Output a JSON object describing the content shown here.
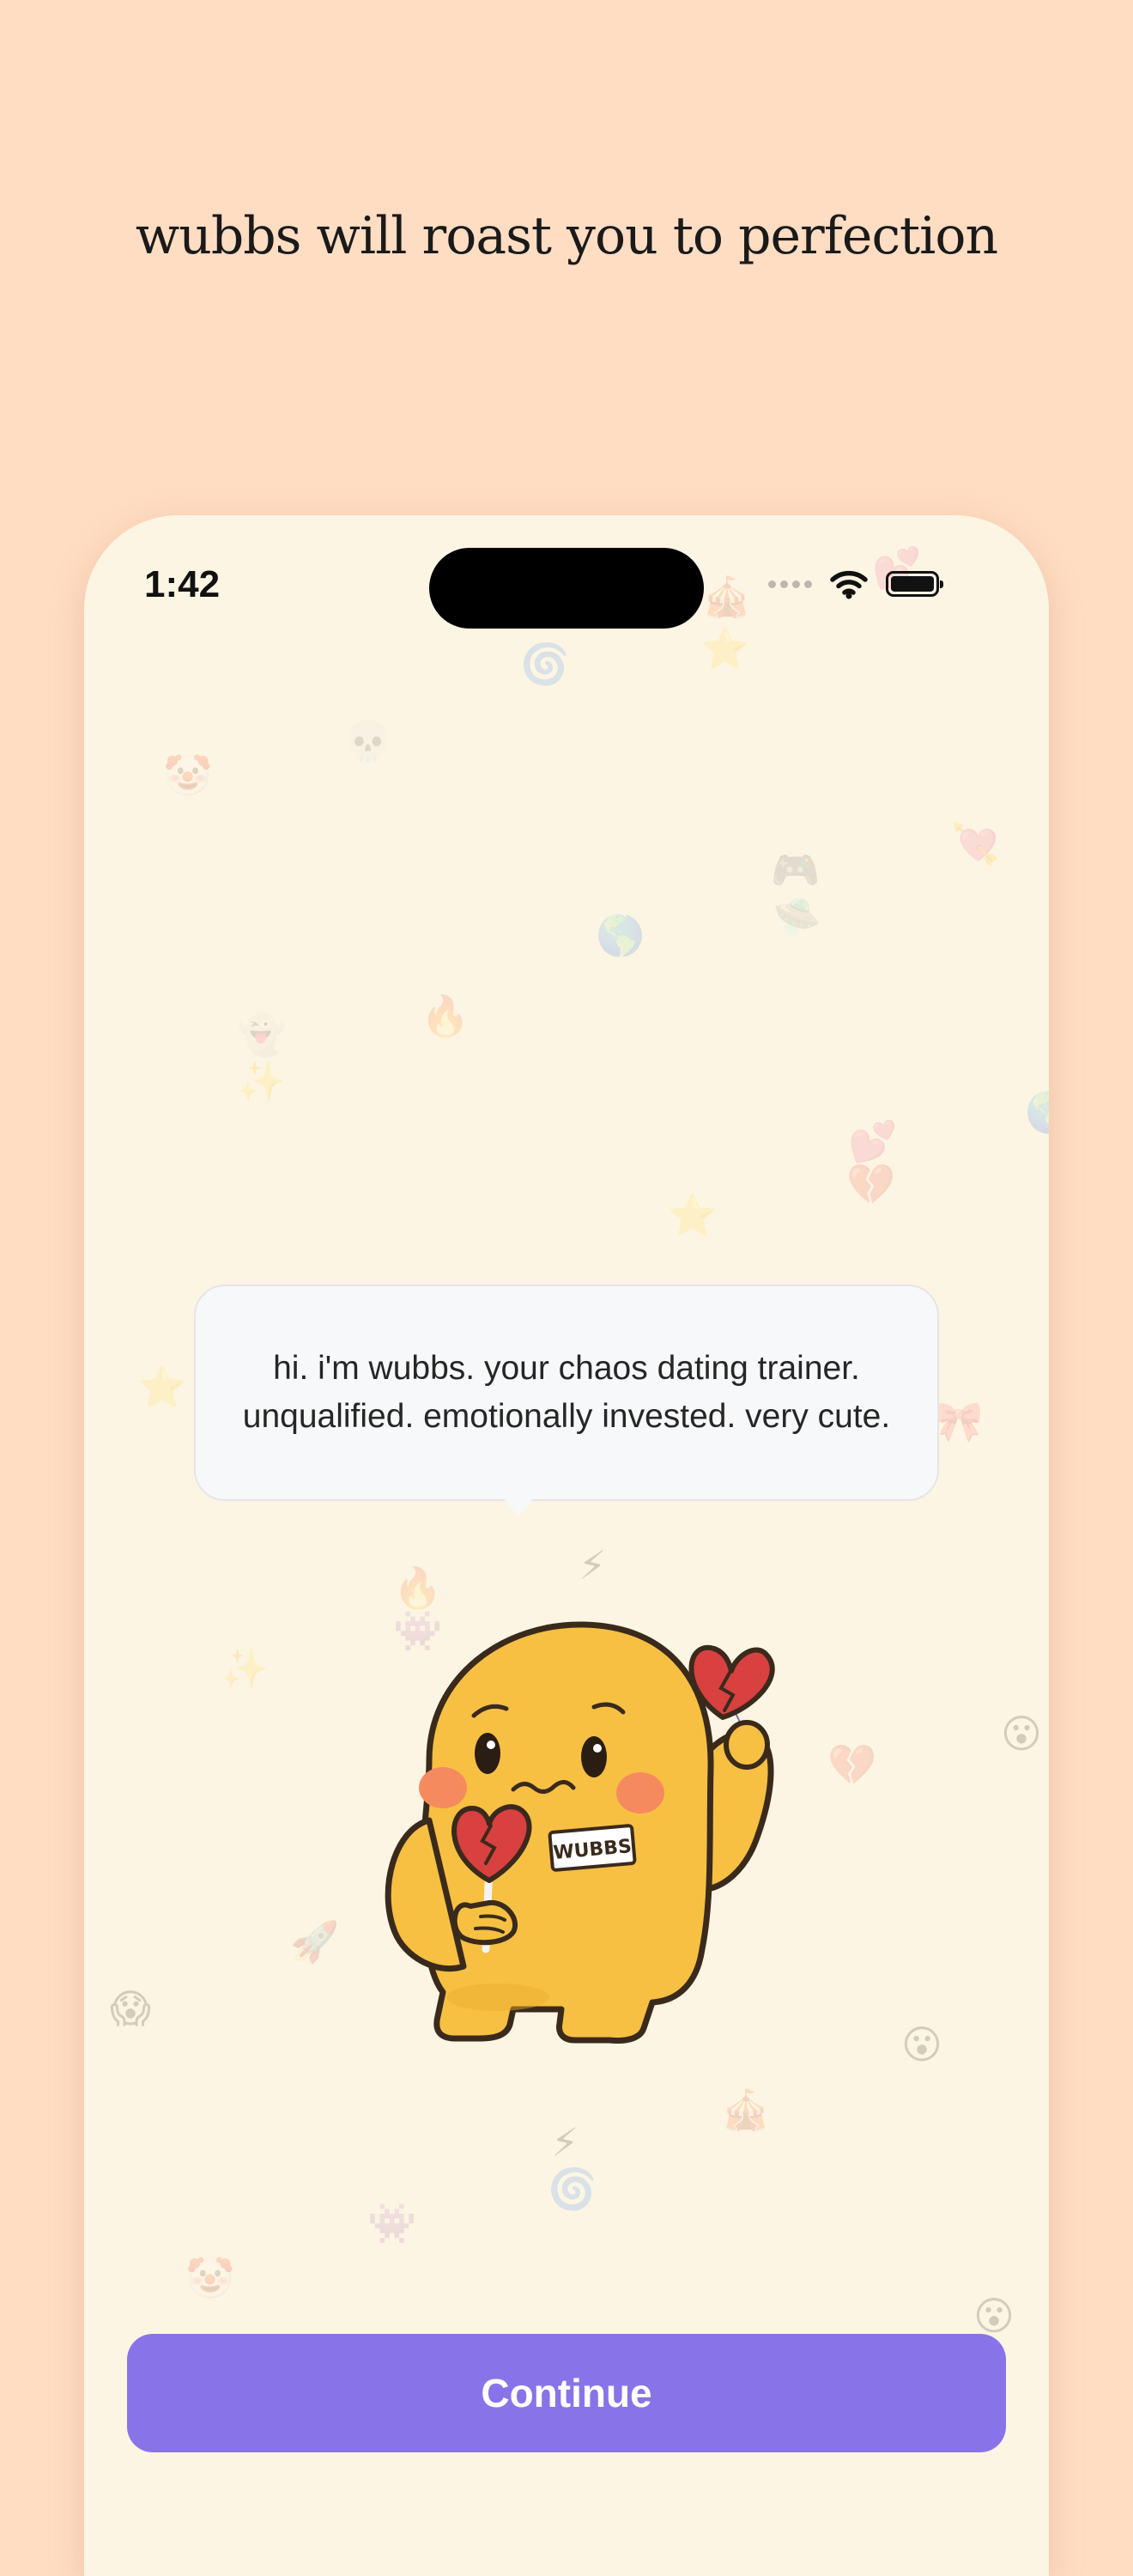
{
  "page": {
    "headline": "wubbs will roast you to perfection"
  },
  "status_bar": {
    "time": "1:42",
    "icons": [
      "cellular-signal-icon",
      "wifi-icon",
      "battery-icon"
    ]
  },
  "speech_bubble": {
    "text": "hi. i'm wubbs. your chaos dating trainer. unqualified. emotionally invested. very cute."
  },
  "mascot": {
    "name_tag": "WUBBS"
  },
  "continue_button": {
    "label": "Continue"
  },
  "colors": {
    "background": "#FFDDC3",
    "phone_screen": "#FDF5E3",
    "button": "#8874E8",
    "mascot_body": "#F7C043",
    "heart": "#D94040"
  }
}
